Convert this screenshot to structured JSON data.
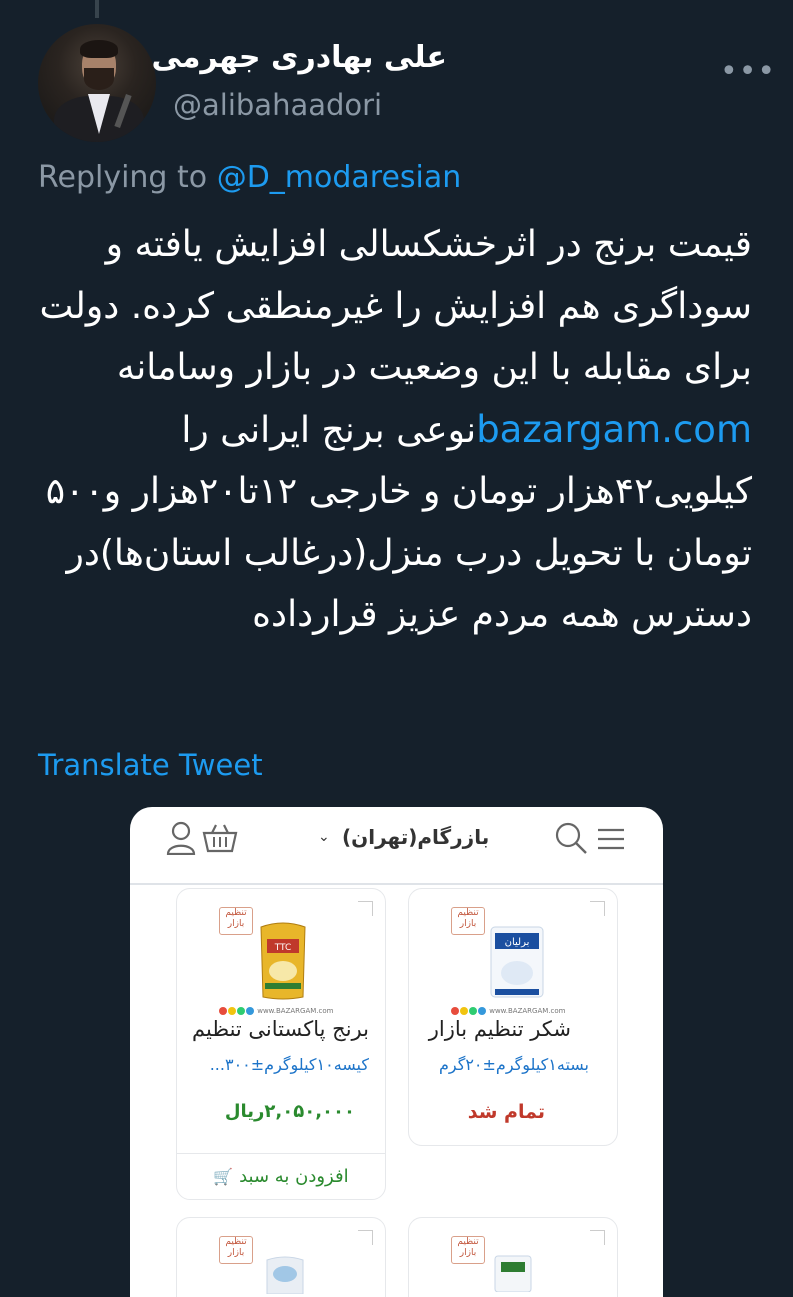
{
  "tweet": {
    "author_name": "علی بهادری جهرمی",
    "author_handle": "@alibahaadori",
    "replying_prefix": "Replying to",
    "replying_to": "@D_modaresian",
    "text_before_link": "قیمت برنج در اثرخشکسالی افزایش یافته و سوداگری هم افزایش را غیرمنطقی کرده. دولت برای مقابله با این وضعیت در بازار وسامانه ",
    "link": "bazargam.com",
    "text_after_link": "نوعی برنج ایرانی را کیلویی۴۲هزار تومان و خارجی ۱۲تا۲۰هزار و۵۰۰ تومان با تحویل درب منزل(درغالب استان‌ها)در دسترس همه مردم عزیز قرارداده",
    "translate_label": "Translate Tweet",
    "more_label": "•••"
  },
  "screenshot": {
    "header_title": "بازرگام(تهران)",
    "chevron": "⌄",
    "badge_text": "تنظیم بازار",
    "logo_text": "www.BAZARGAM.com",
    "products": [
      {
        "name": "شکر تنظیم بازار",
        "desc": "بسته۱کیلوگرم±۲۰گرم",
        "status": "تمام شد"
      },
      {
        "name": "برنج پاکستانی تنظیم",
        "desc": "کیسه۱۰کیلوگرم±۳۰۰...",
        "price": "۲,۰۵۰,۰۰۰ریال",
        "cart_label": "افزودن به سبد"
      }
    ]
  },
  "colors": {
    "background": "#15202b",
    "link": "#1d9bf0",
    "secondary_text": "#8b98a5"
  }
}
